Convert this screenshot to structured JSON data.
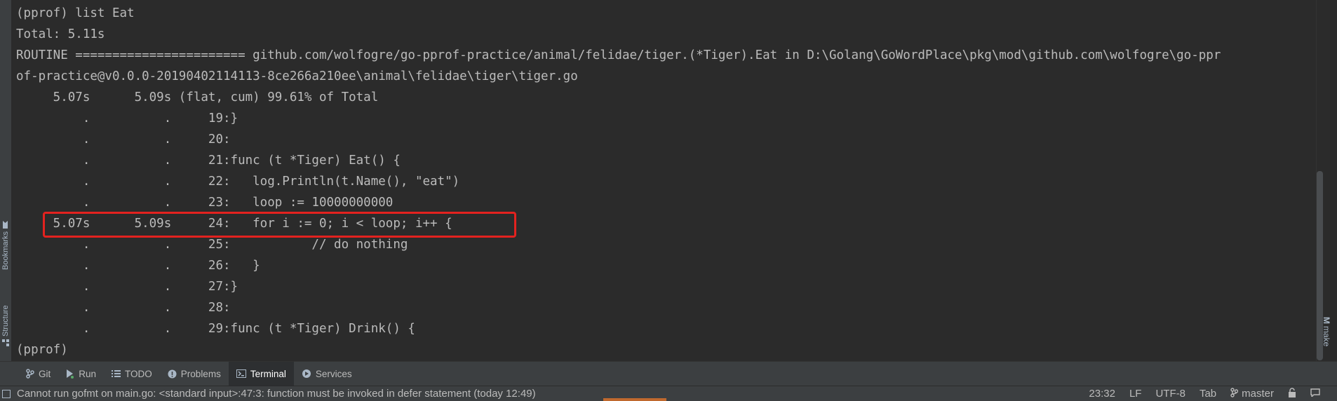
{
  "left_strip": {
    "bookmarks_label": "Bookmarks",
    "structure_label": "Structure"
  },
  "terminal": {
    "lines": [
      "(pprof) list Eat",
      "Total: 5.11s",
      "ROUTINE ======================= github.com/wolfogre/go-pprof-practice/animal/felidae/tiger.(*Tiger).Eat in D:\\Golang\\GoWordPlace\\pkg\\mod\\github.com\\wolfogre\\go-ppr",
      "of-practice@v0.0.0-20190402114113-8ce266a210ee\\animal\\felidae\\tiger\\tiger.go",
      "     5.07s      5.09s (flat, cum) 99.61% of Total",
      "         .          .     19:}",
      "         .          .     20:",
      "         .          .     21:func (t *Tiger) Eat() {",
      "         .          .     22:   log.Println(t.Name(), \"eat\")",
      "         .          .     23:   loop := 10000000000",
      "     5.07s      5.09s     24:   for i := 0; i < loop; i++ {",
      "         .          .     25:           // do nothing",
      "         .          .     26:   }",
      "         .          .     27:}",
      "         .          .     28:",
      "         .          .     29:func (t *Tiger) Drink() {",
      "(pprof)"
    ]
  },
  "right_strip": {
    "make_label": "make"
  },
  "tool_tabs": [
    {
      "label": "Git",
      "icon": "git-branch-icon",
      "active": false
    },
    {
      "label": "Run",
      "icon": "run-icon",
      "active": false
    },
    {
      "label": "TODO",
      "icon": "todo-list-icon",
      "active": false
    },
    {
      "label": "Problems",
      "icon": "problems-icon",
      "active": false
    },
    {
      "label": "Terminal",
      "icon": "terminal-icon",
      "active": true
    },
    {
      "label": "Services",
      "icon": "services-icon",
      "active": false
    }
  ],
  "status_bar": {
    "message": "Cannot run gofmt on main.go: <standard input>:47:3: function must be invoked in defer statement (today 12:49)",
    "position": "23:32",
    "line_separator": "LF",
    "encoding": "UTF-8",
    "indent": "Tab",
    "branch": "master"
  },
  "colors": {
    "terminal_bg": "#2b2b2b",
    "terminal_text": "#bbbbbb",
    "highlight_border": "#e3221f",
    "toolbar_bg": "#3c3f41"
  }
}
